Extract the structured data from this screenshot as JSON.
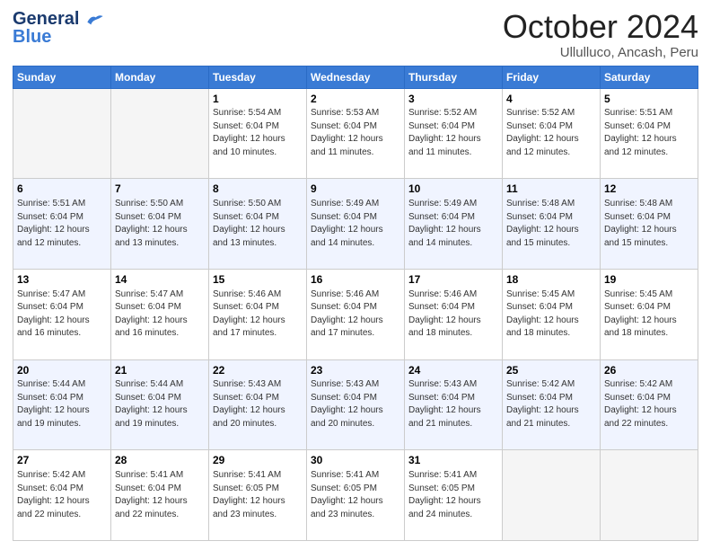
{
  "logo": {
    "line1": "General",
    "line2": "Blue"
  },
  "header": {
    "month": "October 2024",
    "location": "Ullulluco, Ancash, Peru"
  },
  "weekdays": [
    "Sunday",
    "Monday",
    "Tuesday",
    "Wednesday",
    "Thursday",
    "Friday",
    "Saturday"
  ],
  "weeks": [
    [
      {
        "day": "",
        "info": ""
      },
      {
        "day": "",
        "info": ""
      },
      {
        "day": "1",
        "info": "Sunrise: 5:54 AM\nSunset: 6:04 PM\nDaylight: 12 hours and 10 minutes."
      },
      {
        "day": "2",
        "info": "Sunrise: 5:53 AM\nSunset: 6:04 PM\nDaylight: 12 hours and 11 minutes."
      },
      {
        "day": "3",
        "info": "Sunrise: 5:52 AM\nSunset: 6:04 PM\nDaylight: 12 hours and 11 minutes."
      },
      {
        "day": "4",
        "info": "Sunrise: 5:52 AM\nSunset: 6:04 PM\nDaylight: 12 hours and 12 minutes."
      },
      {
        "day": "5",
        "info": "Sunrise: 5:51 AM\nSunset: 6:04 PM\nDaylight: 12 hours and 12 minutes."
      }
    ],
    [
      {
        "day": "6",
        "info": "Sunrise: 5:51 AM\nSunset: 6:04 PM\nDaylight: 12 hours and 12 minutes."
      },
      {
        "day": "7",
        "info": "Sunrise: 5:50 AM\nSunset: 6:04 PM\nDaylight: 12 hours and 13 minutes."
      },
      {
        "day": "8",
        "info": "Sunrise: 5:50 AM\nSunset: 6:04 PM\nDaylight: 12 hours and 13 minutes."
      },
      {
        "day": "9",
        "info": "Sunrise: 5:49 AM\nSunset: 6:04 PM\nDaylight: 12 hours and 14 minutes."
      },
      {
        "day": "10",
        "info": "Sunrise: 5:49 AM\nSunset: 6:04 PM\nDaylight: 12 hours and 14 minutes."
      },
      {
        "day": "11",
        "info": "Sunrise: 5:48 AM\nSunset: 6:04 PM\nDaylight: 12 hours and 15 minutes."
      },
      {
        "day": "12",
        "info": "Sunrise: 5:48 AM\nSunset: 6:04 PM\nDaylight: 12 hours and 15 minutes."
      }
    ],
    [
      {
        "day": "13",
        "info": "Sunrise: 5:47 AM\nSunset: 6:04 PM\nDaylight: 12 hours and 16 minutes."
      },
      {
        "day": "14",
        "info": "Sunrise: 5:47 AM\nSunset: 6:04 PM\nDaylight: 12 hours and 16 minutes."
      },
      {
        "day": "15",
        "info": "Sunrise: 5:46 AM\nSunset: 6:04 PM\nDaylight: 12 hours and 17 minutes."
      },
      {
        "day": "16",
        "info": "Sunrise: 5:46 AM\nSunset: 6:04 PM\nDaylight: 12 hours and 17 minutes."
      },
      {
        "day": "17",
        "info": "Sunrise: 5:46 AM\nSunset: 6:04 PM\nDaylight: 12 hours and 18 minutes."
      },
      {
        "day": "18",
        "info": "Sunrise: 5:45 AM\nSunset: 6:04 PM\nDaylight: 12 hours and 18 minutes."
      },
      {
        "day": "19",
        "info": "Sunrise: 5:45 AM\nSunset: 6:04 PM\nDaylight: 12 hours and 18 minutes."
      }
    ],
    [
      {
        "day": "20",
        "info": "Sunrise: 5:44 AM\nSunset: 6:04 PM\nDaylight: 12 hours and 19 minutes."
      },
      {
        "day": "21",
        "info": "Sunrise: 5:44 AM\nSunset: 6:04 PM\nDaylight: 12 hours and 19 minutes."
      },
      {
        "day": "22",
        "info": "Sunrise: 5:43 AM\nSunset: 6:04 PM\nDaylight: 12 hours and 20 minutes."
      },
      {
        "day": "23",
        "info": "Sunrise: 5:43 AM\nSunset: 6:04 PM\nDaylight: 12 hours and 20 minutes."
      },
      {
        "day": "24",
        "info": "Sunrise: 5:43 AM\nSunset: 6:04 PM\nDaylight: 12 hours and 21 minutes."
      },
      {
        "day": "25",
        "info": "Sunrise: 5:42 AM\nSunset: 6:04 PM\nDaylight: 12 hours and 21 minutes."
      },
      {
        "day": "26",
        "info": "Sunrise: 5:42 AM\nSunset: 6:04 PM\nDaylight: 12 hours and 22 minutes."
      }
    ],
    [
      {
        "day": "27",
        "info": "Sunrise: 5:42 AM\nSunset: 6:04 PM\nDaylight: 12 hours and 22 minutes."
      },
      {
        "day": "28",
        "info": "Sunrise: 5:41 AM\nSunset: 6:04 PM\nDaylight: 12 hours and 22 minutes."
      },
      {
        "day": "29",
        "info": "Sunrise: 5:41 AM\nSunset: 6:05 PM\nDaylight: 12 hours and 23 minutes."
      },
      {
        "day": "30",
        "info": "Sunrise: 5:41 AM\nSunset: 6:05 PM\nDaylight: 12 hours and 23 minutes."
      },
      {
        "day": "31",
        "info": "Sunrise: 5:41 AM\nSunset: 6:05 PM\nDaylight: 12 hours and 24 minutes."
      },
      {
        "day": "",
        "info": ""
      },
      {
        "day": "",
        "info": ""
      }
    ]
  ]
}
